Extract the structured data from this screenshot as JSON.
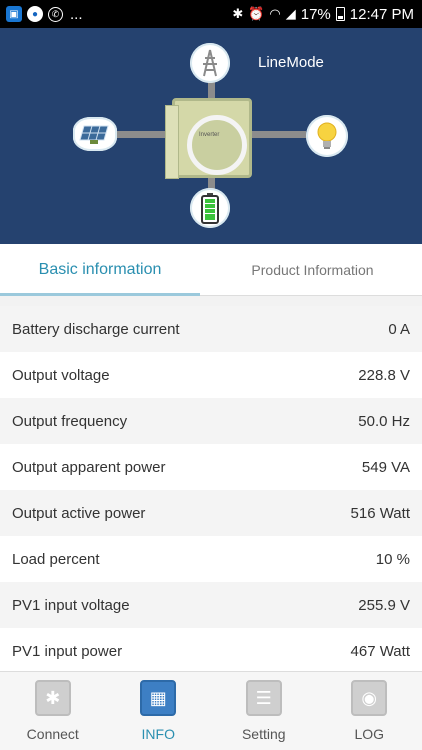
{
  "status_bar": {
    "battery_percent": "17%",
    "time": "12:47 PM",
    "overflow": "...",
    "left_icons": [
      "gallery-icon",
      "app-icon",
      "whatsapp-icon"
    ],
    "right_icons": [
      "bluetooth-icon",
      "alarm-icon",
      "wifi-icon",
      "signal-icon",
      "battery-icon"
    ]
  },
  "hero": {
    "mode": "LineMode",
    "inverter_label": "Inverter",
    "nodes": [
      "grid-tower-icon",
      "solar-panel-icon",
      "light-bulb-icon",
      "battery-icon"
    ]
  },
  "tabs": {
    "basic": "Basic information",
    "product": "Product Information",
    "active": "basic"
  },
  "info": {
    "rows": [
      {
        "label": "Battery discharge current",
        "value": "0 A"
      },
      {
        "label": "Output voltage",
        "value": "228.8 V"
      },
      {
        "label": "Output frequency",
        "value": "50.0 Hz"
      },
      {
        "label": "Output apparent power",
        "value": "549 VA"
      },
      {
        "label": "Output active power",
        "value": "516 Watt"
      },
      {
        "label": "Load percent",
        "value": "10 %"
      },
      {
        "label": "PV1 input voltage",
        "value": "255.9 V"
      },
      {
        "label": "PV1 input power",
        "value": "467 Watt"
      }
    ]
  },
  "nav": {
    "items": [
      {
        "label": "Connect",
        "icon": "bluetooth-icon"
      },
      {
        "label": "INFO",
        "icon": "info-chart-icon"
      },
      {
        "label": "Setting",
        "icon": "sliders-icon"
      },
      {
        "label": "LOG",
        "icon": "log-icon"
      }
    ],
    "active": "INFO"
  },
  "colors": {
    "hero_bg": "#25426f",
    "accent": "#2a8fb0",
    "nav_active": "#3d7fc4"
  }
}
